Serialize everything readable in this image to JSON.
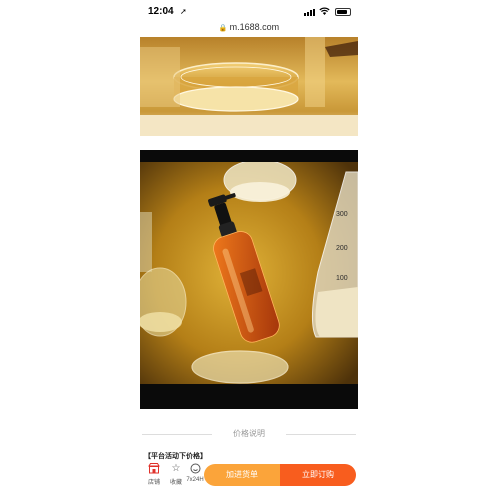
{
  "status_bar": {
    "time": "12:04",
    "location_arrow": "➚"
  },
  "browser": {
    "url": "m.1688.com"
  },
  "images": [
    {
      "name": "lab-glassware-amber-liquid"
    },
    {
      "name": "hair-oil-pump-bottle-with-flasks"
    }
  ],
  "section": {
    "price_title": "价格说明",
    "promo_label": "【平台活动下价格】"
  },
  "bottom_bar": {
    "tabs": [
      {
        "label": "店铺",
        "icon": "shop-icon"
      },
      {
        "label": "收藏",
        "icon": "star-icon"
      },
      {
        "label": "7x24H",
        "icon": "service-icon"
      }
    ],
    "add_to_cart": "加进货单",
    "buy_now": "立即订购"
  },
  "colors": {
    "add_to_cart": "#fba43a",
    "buy_now": "#f85d1e",
    "accent_red": "#e0322b"
  }
}
